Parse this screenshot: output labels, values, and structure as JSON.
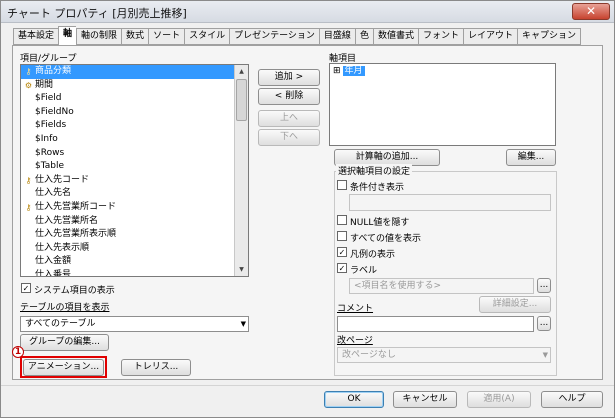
{
  "window": {
    "title": "チャート プロパティ [月別売上推移]",
    "close_glyph": "✕"
  },
  "tabs": [
    "基本設定",
    "軸",
    "軸の制限",
    "数式",
    "ソート",
    "スタイル",
    "プレゼンテーション",
    "目盛線",
    "色",
    "数値書式",
    "フォント",
    "レイアウト",
    "キャプション"
  ],
  "active_tab": "軸",
  "left": {
    "fields_label": "項目/グループ",
    "fields": [
      {
        "label": "商品分類",
        "icon": "key-icon",
        "selected": true
      },
      {
        "label": "期間",
        "icon": "hierarchy-icon",
        "selected": false
      },
      {
        "label": "$Field",
        "icon": "",
        "selected": false
      },
      {
        "label": "$FieldNo",
        "icon": "",
        "selected": false
      },
      {
        "label": "$Fields",
        "icon": "",
        "selected": false
      },
      {
        "label": "$Info",
        "icon": "",
        "selected": false
      },
      {
        "label": "$Rows",
        "icon": "",
        "selected": false
      },
      {
        "label": "$Table",
        "icon": "",
        "selected": false
      },
      {
        "label": "仕入先コード",
        "icon": "key-icon",
        "selected": false
      },
      {
        "label": "仕入先名",
        "icon": "",
        "selected": false
      },
      {
        "label": "仕入先営業所コード",
        "icon": "key-icon",
        "selected": false
      },
      {
        "label": "仕入先営業所名",
        "icon": "",
        "selected": false
      },
      {
        "label": "仕入先営業所表示順",
        "icon": "",
        "selected": false
      },
      {
        "label": "仕入先表示順",
        "icon": "",
        "selected": false
      },
      {
        "label": "仕入金額",
        "icon": "",
        "selected": false
      },
      {
        "label": "仕入番号",
        "icon": "",
        "selected": false
      }
    ],
    "show_system_label": "システム項目の表示",
    "show_system_checked": true,
    "table_label": "テーブルの項目を表示",
    "table_value": "すべてのテーブル",
    "group_edit_button": "グループの編集...",
    "animation_button": "アニメーション...",
    "trellis_button": "トレリス...",
    "marker": "1"
  },
  "middle": {
    "add_button": "追加 >",
    "remove_button": "< 削除",
    "up_button": "上へ",
    "down_button": "下へ"
  },
  "right": {
    "axis_label": "軸項目",
    "axis_items": [
      {
        "label": "年月",
        "expander": "⊞"
      }
    ],
    "calc_axis_button": "計算軸の追加...",
    "edit_button": "編集...",
    "settings_group_label": "選択軸項目の設定",
    "conditional_label": "条件付き表示",
    "conditional_checked": false,
    "hide_null_label": "NULL値を隠す",
    "hide_null_checked": false,
    "show_all_label": "すべての値を表示",
    "show_all_checked": false,
    "show_legend_label": "凡例の表示",
    "show_legend_checked": true,
    "label_label": "ラベル",
    "label_checked": true,
    "label_placeholder": "<項目名を使用する>",
    "comment_label": "コメント",
    "detail_button": "詳細設定...",
    "pagebreak_label": "改ページ",
    "pagebreak_value": "改ページなし",
    "ellipsis": "..."
  },
  "footer": {
    "ok": "OK",
    "cancel": "キャンセル",
    "apply": "適用(A)",
    "help": "ヘルプ"
  }
}
